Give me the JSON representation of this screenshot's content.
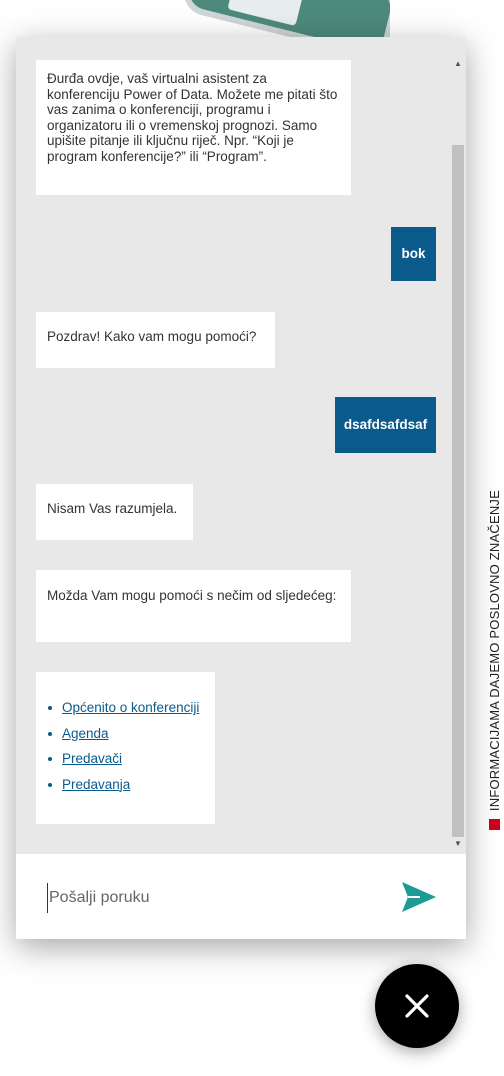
{
  "side_banner": {
    "text": "INFORMACIJAMA DAJEMO POSLOVNO ZNAČENJE",
    "square_color": "#d0021b"
  },
  "chat": {
    "messages": [
      {
        "from": "bot",
        "text": "Đurđa ovdje, vaš virtualni asistent za konferenciju Power of Data. Možete me pitati što vas zanima o konferenciji, programu i organizatoru ili o vremenskoj prognozi. Samo upišite pitanje ili ključnu riječ. Npr. “Koji je program konferencije?” ili “Program”."
      },
      {
        "from": "user",
        "text": "bok"
      },
      {
        "from": "bot",
        "text": "Pozdrav! Kako vam mogu pomoći?"
      },
      {
        "from": "user",
        "text": "dsafdsafdsaf"
      },
      {
        "from": "bot",
        "text": "Nisam Vas razumjela."
      },
      {
        "from": "bot",
        "text": "Možda Vam mogu pomoći s nečim od sljedećeg:"
      }
    ],
    "suggestions": [
      "Općenito o konferenciji",
      "Agenda",
      "Predavači",
      "Predavanja"
    ],
    "composer": {
      "placeholder": "Pošalji poruku",
      "value": ""
    },
    "colors": {
      "user_bubble": "#0b5a8c",
      "send_icon": "#1a9c94",
      "background": "#e8e8e8"
    }
  },
  "icons": {
    "send": "send-arrow-icon",
    "close": "close-icon",
    "scroll_up": "triangle-up-icon",
    "scroll_down": "triangle-down-icon"
  }
}
